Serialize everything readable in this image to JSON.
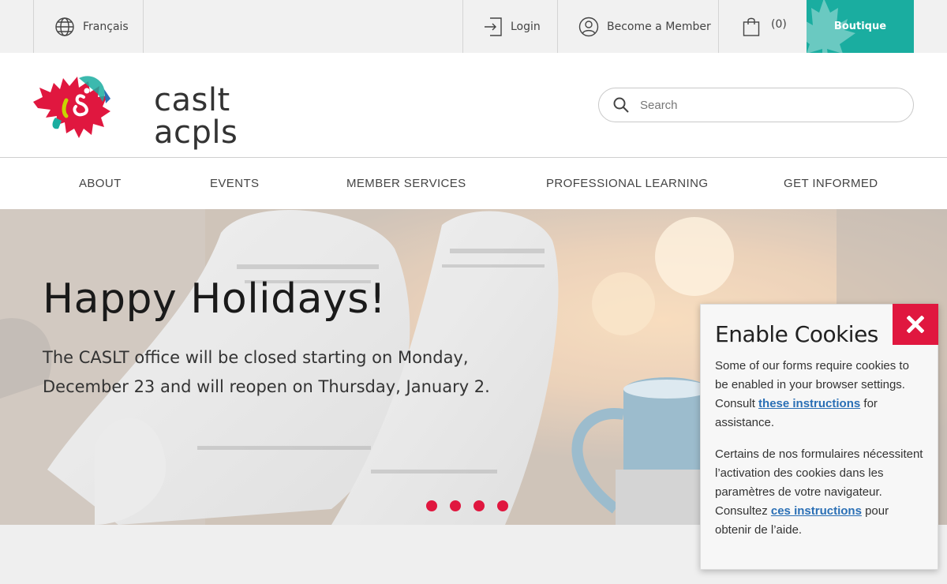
{
  "topbar": {
    "language": "Français",
    "login": "Login",
    "member": "Become a Member",
    "cart_count": "(0)",
    "boutique": "Boutique"
  },
  "logo": {
    "line1": "caslt",
    "line2": "acpls"
  },
  "search": {
    "placeholder": "Search"
  },
  "nav": {
    "items": [
      {
        "label": "ABOUT"
      },
      {
        "label": "EVENTS"
      },
      {
        "label": "MEMBER SERVICES"
      },
      {
        "label": "PROFESSIONAL LEARNING"
      },
      {
        "label": "GET INFORMED"
      }
    ]
  },
  "hero": {
    "title": "Happy Holidays!",
    "text": "The CASLT office will be closed starting on Monday, December 23 and will reopen on Thursday, January 2.",
    "slide_count": 4
  },
  "cookie": {
    "title": "Enable Cookies",
    "en_before": "Some of our forms require cookies to be enabled in your browser settings. Consult ",
    "en_link": "these instructions",
    "en_after": " for assistance.",
    "fr_before": "Certains de nos formulaires nécessitent l’activation des cookies dans les paramètres de votre navigateur. Consultez ",
    "fr_link": "ces instructions",
    "fr_after": " pour obtenir de l’aide."
  },
  "colors": {
    "accent": "#e0173f",
    "teal": "#1aada0",
    "link": "#2a6fb5"
  }
}
